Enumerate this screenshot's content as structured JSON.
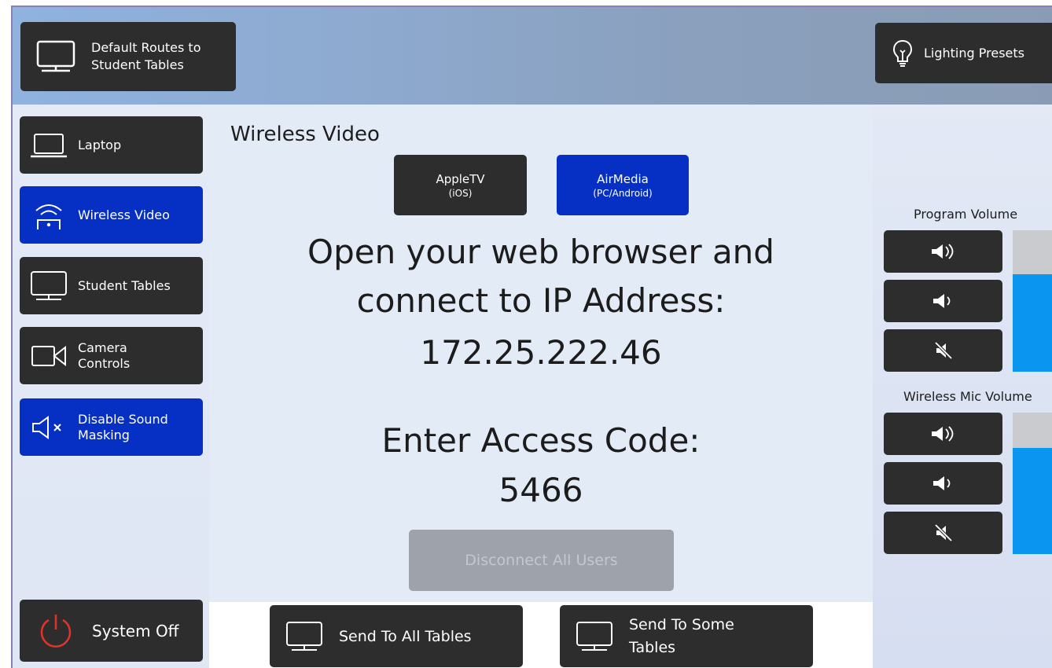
{
  "header": {
    "default_routes_label": "Default Routes to Student Tables",
    "lighting_presets_label": "Lighting Presets"
  },
  "sidebar": {
    "items": [
      {
        "label": "Laptop",
        "icon": "laptop-icon",
        "active": false
      },
      {
        "label": "Wireless Video",
        "icon": "wireless-video-icon",
        "active": true
      },
      {
        "label": "Student Tables",
        "icon": "monitor-icon",
        "active": false
      },
      {
        "label": "Camera Controls",
        "icon": "camera-icon",
        "active": false
      },
      {
        "label": "Disable Sound Masking",
        "icon": "speaker-mute-icon",
        "active": true
      }
    ],
    "system_off_label": "System Off"
  },
  "main": {
    "title": "Wireless Video",
    "sources": [
      {
        "label": "AppleTV",
        "sub": "(iOS)",
        "active": false
      },
      {
        "label": "AirMedia",
        "sub": "(PC/Android)",
        "active": true
      }
    ],
    "instruction_line1": "Open your web browser and",
    "instruction_line2": "connect to IP Address:",
    "ip_address": "172.25.222.46",
    "access_code_label": "Enter Access Code:",
    "access_code": "5466",
    "disconnect_label": "Disconnect All Users"
  },
  "footer": {
    "send_all_label": "Send To All Tables",
    "send_some_label": "Send To Some Tables"
  },
  "volume": {
    "program": {
      "label": "Program Volume",
      "level": 0.69
    },
    "mic": {
      "label": "Wireless Mic Volume",
      "level": 0.75
    }
  },
  "colors": {
    "button_dark": "#2d2d2d",
    "button_active": "#0630c4",
    "meter_fill": "#0a96f0",
    "power_red": "#e0332b"
  }
}
